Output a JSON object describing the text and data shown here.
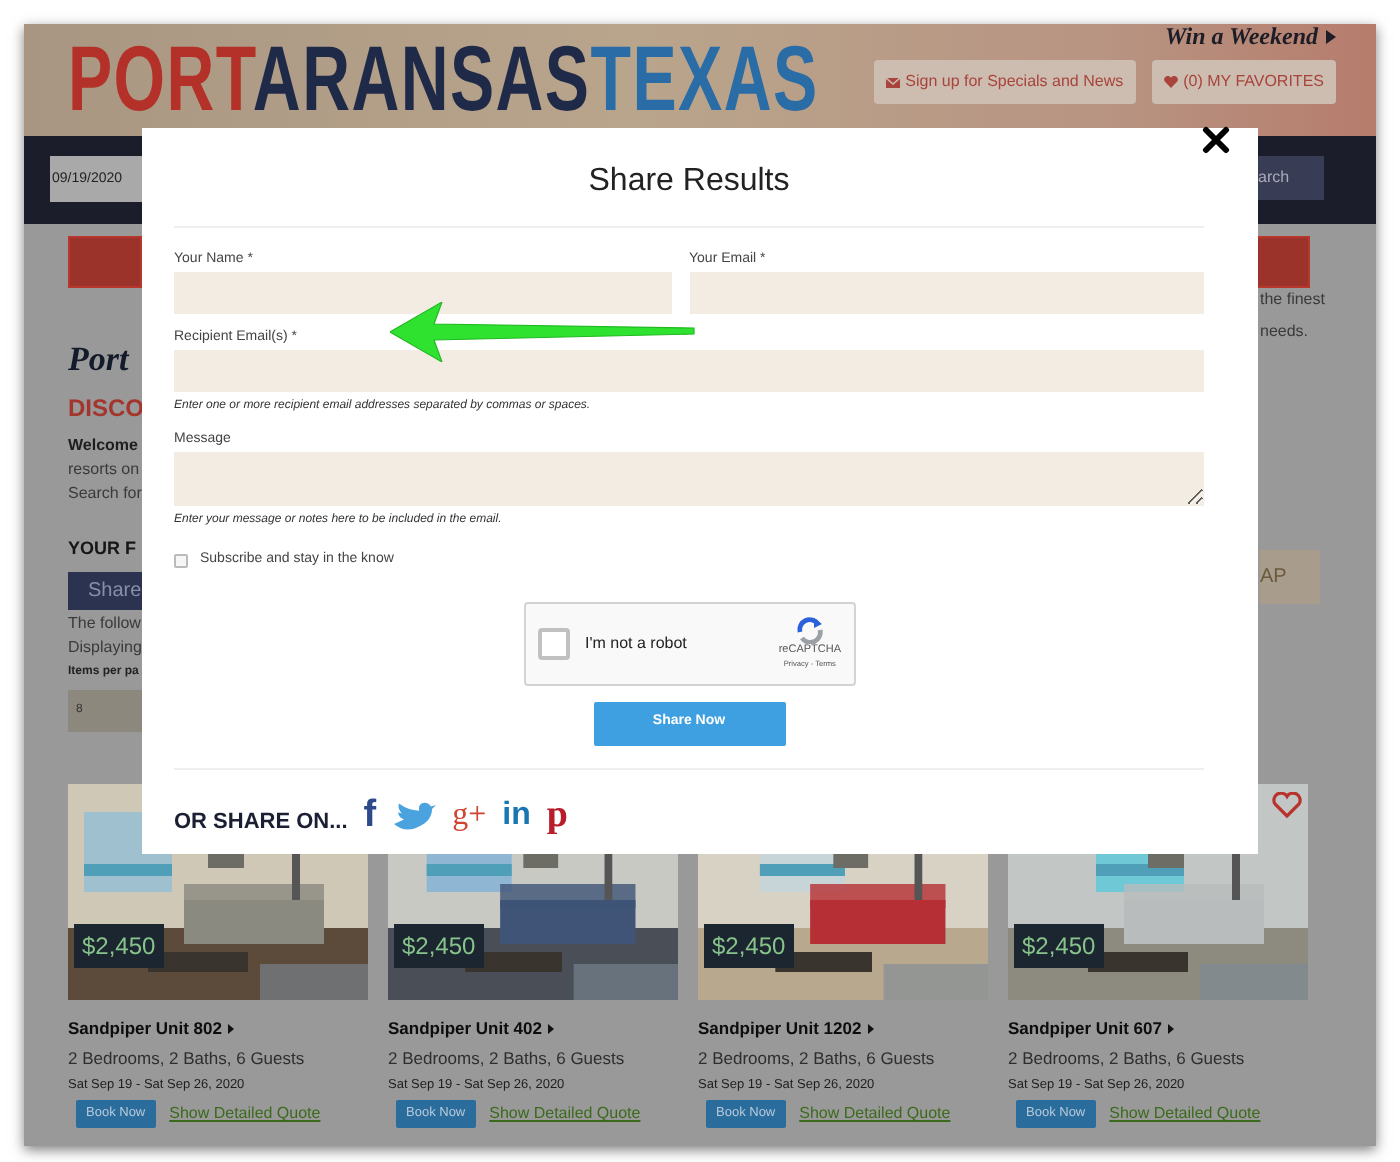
{
  "header": {
    "logo_words": [
      "PORT",
      "ARANSAS",
      "TEXAS"
    ],
    "promo": "Win a Weekend",
    "buttons": [
      {
        "kind": "mail",
        "label": "Sign up for Specials and News"
      },
      {
        "kind": "heart",
        "label": "(0) MY FAVORITES"
      }
    ]
  },
  "search_bar": {
    "date": "09/19/2020",
    "search_button": "arch"
  },
  "page_left": [
    {
      "kind": "title",
      "text": "Port"
    },
    {
      "kind": "heading",
      "text": "DISCO"
    },
    {
      "kind": "bold",
      "text": "Welcome"
    },
    {
      "kind": "text",
      "text": "resorts on"
    },
    {
      "kind": "text",
      "text": "Search for"
    },
    {
      "kind": "section",
      "text": "YOUR F"
    },
    {
      "kind": "button",
      "text": "Share"
    },
    {
      "kind": "text",
      "text": "The follow"
    },
    {
      "kind": "text",
      "text": "Displaying"
    },
    {
      "kind": "label",
      "text": "Items per pa"
    },
    {
      "kind": "select",
      "text": "8"
    }
  ],
  "page_right": [
    {
      "kind": "text",
      "text": "the finest"
    },
    {
      "kind": "text",
      "text": "needs."
    },
    {
      "kind": "button",
      "text": "AP"
    }
  ],
  "modal": {
    "title": "Share Results",
    "fields": [
      {
        "label": "Your Name *",
        "kind": "input",
        "half": true
      },
      {
        "label": "Your Email *",
        "kind": "input",
        "half": true
      },
      {
        "label": "Recipient Email(s) *",
        "kind": "input",
        "half": false,
        "hint": "Enter one or more recipient email addresses separated by commas or spaces."
      },
      {
        "label": "Message",
        "kind": "textarea",
        "half": false,
        "hint": "Enter your message or notes here to be included in the email."
      }
    ],
    "subscribe": {
      "label": "Subscribe and stay in the know",
      "checked": false
    },
    "captcha": {
      "label": "I'm not a robot",
      "checked": false,
      "brand": "reCAPTCHA",
      "links": "Privacy - Terms"
    },
    "submit": "Share Now",
    "share_label": "OR SHARE ON...",
    "share_icons": [
      {
        "kind": "letter",
        "glyph": "f",
        "color": "#2d4a8a"
      },
      {
        "kind": "bird",
        "color": "#4aa3df"
      },
      {
        "kind": "letter",
        "glyph": "g+",
        "color": "#d0442f"
      },
      {
        "kind": "letter",
        "glyph": "in",
        "color": "#1a75b3"
      },
      {
        "kind": "letter",
        "glyph": "p",
        "color": "#b91c2a"
      }
    ]
  },
  "listings": [
    {
      "price": "$2,450",
      "title": "Sandpiper Unit 802",
      "specs": "2 Bedrooms, 2 Baths, 6 Guests",
      "dates": "Sat Sep 19 - Sat Sep 26, 2020",
      "book": "Book Now",
      "quote": "Show Detailed Quote"
    },
    {
      "price": "$2,450",
      "title": "Sandpiper Unit 402",
      "specs": "2 Bedrooms, 2 Baths, 6 Guests",
      "dates": "Sat Sep 19 - Sat Sep 26, 2020",
      "book": "Book Now",
      "quote": "Show Detailed Quote"
    },
    {
      "price": "$2,450",
      "title": "Sandpiper Unit 1202",
      "specs": "2 Bedrooms, 2 Baths, 6 Guests",
      "dates": "Sat Sep 19 - Sat Sep 26, 2020",
      "book": "Book Now",
      "quote": "Show Detailed Quote"
    },
    {
      "price": "$2,450",
      "title": "Sandpiper Unit 607",
      "specs": "2 Bedrooms, 2 Baths, 6 Guests",
      "dates": "Sat Sep 19 - Sat Sep 26, 2020",
      "book": "Book Now",
      "quote": "Show Detailed Quote",
      "favorite": false
    }
  ]
}
